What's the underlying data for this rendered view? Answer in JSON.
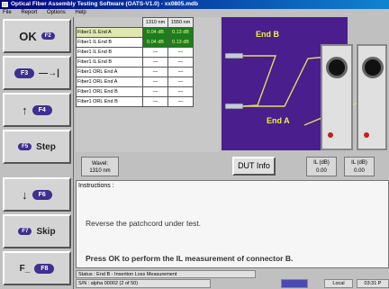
{
  "window": {
    "title": "Optical Fiber Assembly Testing Software (OATS-V1.0) - xx0805.mdb"
  },
  "menu": [
    "File",
    "Report",
    "Options",
    "Help"
  ],
  "fbuttons": [
    {
      "label": "OK",
      "key": "F2"
    },
    {
      "label": "—→|",
      "key": "F3"
    },
    {
      "label": "↑",
      "key": "F4"
    },
    {
      "label": "Step",
      "key": "F5"
    },
    {
      "label": "↓",
      "key": "F6"
    },
    {
      "label": "Skip",
      "key": "F7"
    },
    {
      "label": "F_",
      "key": "F8"
    }
  ],
  "results": {
    "columns": [
      "1310 nm",
      "1550 nm"
    ],
    "rows": [
      {
        "label": "Fiber1 IL End A",
        "values": [
          "0.04 dB",
          "0.13 dB"
        ],
        "highlight": true
      },
      {
        "label": "Fiber1 IL End B",
        "values": [
          "0.04 dB",
          "0.13 dB"
        ],
        "highlight": true
      },
      {
        "label": "Fiber1 IL End B",
        "values": [
          "—",
          "—"
        ],
        "highlight": false
      },
      {
        "label": "Fiber1 IL End B",
        "values": [
          "—",
          "—"
        ],
        "highlight": false
      },
      {
        "label": "Fiber1 ORL End A",
        "values": [
          "—",
          "—"
        ],
        "highlight": false
      },
      {
        "label": "Fiber1 ORL End A",
        "values": [
          "—",
          "—"
        ],
        "highlight": false
      },
      {
        "label": "Fiber1 ORL End B",
        "values": [
          "—",
          "—"
        ],
        "highlight": false
      },
      {
        "label": "Fiber1 ORL End B",
        "values": [
          "—",
          "—"
        ],
        "highlight": false
      }
    ]
  },
  "diagram": {
    "end_b": "End B",
    "end_a": "End A"
  },
  "wave_box": {
    "line1": "Wavel:",
    "line2": "1310 nm"
  },
  "dut_info_label": "DUT Info",
  "box_a": {
    "line1": "IL (dB)",
    "line2": "0.00"
  },
  "box_b": {
    "line1": "IL (dB)",
    "line2": "0.00"
  },
  "instructions": {
    "heading": "Instructions :",
    "line1": "Reverse the patchcord under test.",
    "line2": "Press OK to perform the IL measurement of connector B."
  },
  "status": {
    "line1": "Status : End B - Insertion Loss Measurement",
    "line2": "S/N : alpha 00002  (2 of 50)",
    "local": "Local",
    "time": "03:31 P"
  },
  "colors": {
    "panel": "#4a1e8c",
    "accent": "#3d3090",
    "good": "#1e7d1e"
  }
}
